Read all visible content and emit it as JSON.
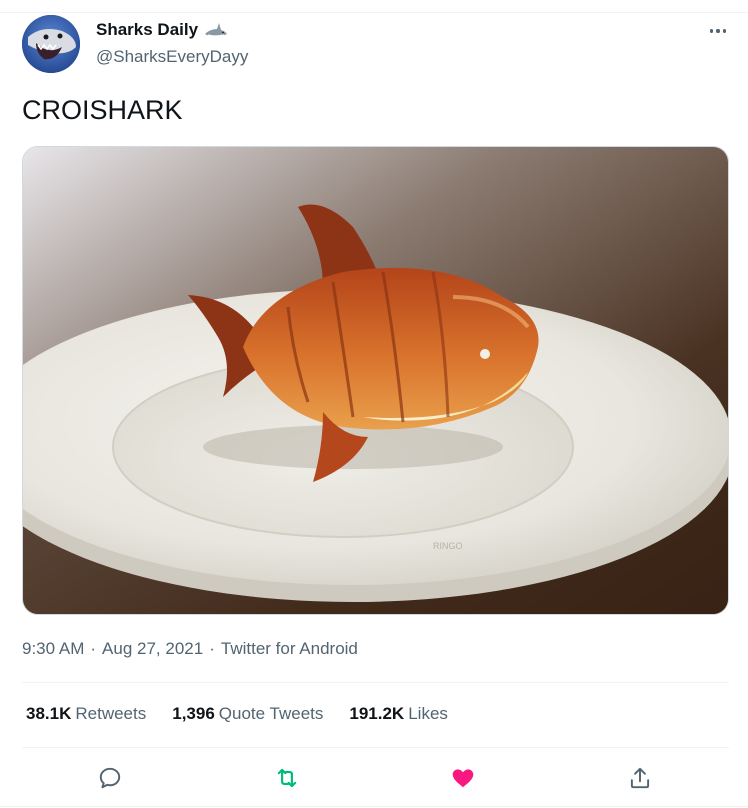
{
  "user": {
    "display_name": "Sharks Daily",
    "handle": "@SharksEveryDayy",
    "name_emoji_icon": "shark-icon"
  },
  "tweet": {
    "text": "CROISHARK",
    "image_watermark": "RINGO",
    "time": "9:30 AM",
    "sep1": "·",
    "date": "Aug 27, 2021",
    "sep2": "·",
    "source": "Twitter for Android"
  },
  "stats": {
    "retweets_count": "38.1K",
    "retweets_label": "Retweets",
    "quotes_count": "1,396",
    "quotes_label": "Quote Tweets",
    "likes_count": "191.2K",
    "likes_label": "Likes"
  },
  "actions": {
    "reply_icon": "reply-icon",
    "retweet_icon": "retweet-icon",
    "like_icon": "heart-icon",
    "share_icon": "share-icon"
  },
  "colors": {
    "retweet_green": "#00ba7c",
    "like_pink": "#f91880",
    "secondary_text": "#536471"
  }
}
